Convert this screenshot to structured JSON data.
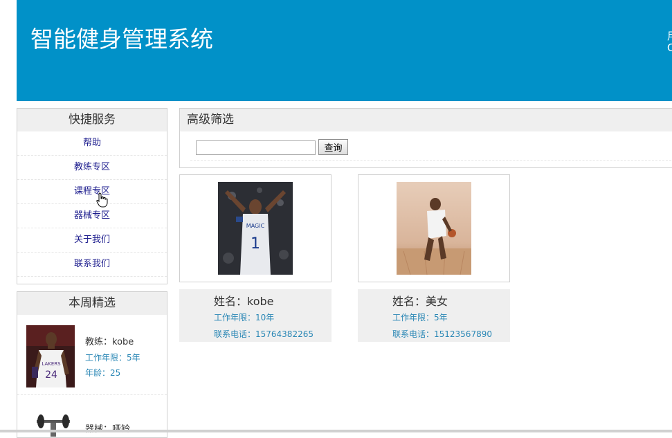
{
  "header": {
    "title": "智能健身管理系统",
    "side_line1": "用",
    "side_line2": "C"
  },
  "quick_service": {
    "title": "快捷服务",
    "items": [
      {
        "label": "帮助"
      },
      {
        "label": "教练专区"
      },
      {
        "label": "课程专区"
      },
      {
        "label": "器械专区"
      },
      {
        "label": "关于我们"
      },
      {
        "label": "联系我们"
      }
    ]
  },
  "weekly_picks": {
    "title": "本周精选",
    "items": [
      {
        "name": "教练：kobe",
        "years": "工作年限：5年",
        "age": "年龄：25"
      },
      {
        "name": "器械：哑铃"
      }
    ]
  },
  "filter": {
    "title": "高级筛选",
    "search_value": "",
    "search_button": "查询"
  },
  "coaches": [
    {
      "name": "姓名：kobe",
      "years": "工作年限：10年",
      "phone": "联系电话：15764382265"
    },
    {
      "name": "姓名：美女",
      "years": "工作年限：5年",
      "phone": "联系电话：15123567890"
    }
  ],
  "colors": {
    "header_bg": "#0191c8",
    "link": "#1a1a8c",
    "info_text": "#2a87b5",
    "panel_head_bg": "#efefef"
  }
}
